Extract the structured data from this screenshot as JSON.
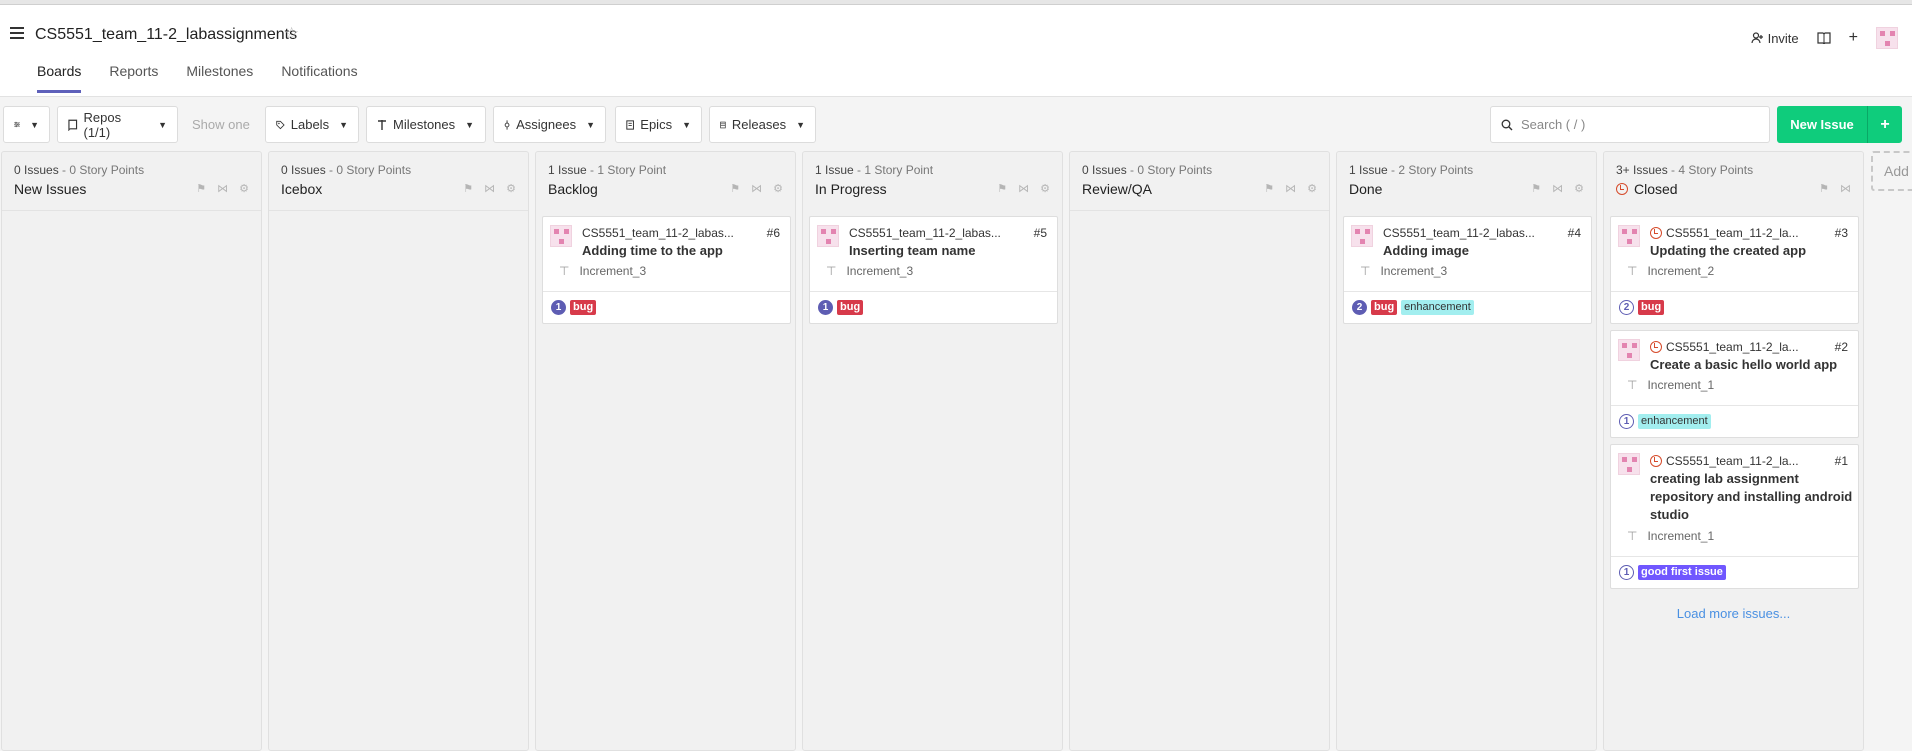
{
  "header": {
    "project_title": "CS5551_team_11-2_labassignments",
    "invite_label": "Invite",
    "tabs": [
      {
        "label": "Boards"
      },
      {
        "label": "Reports"
      },
      {
        "label": "Milestones"
      },
      {
        "label": "Notifications"
      }
    ]
  },
  "toolbar": {
    "repos_label": "Repos (1/1)",
    "show_one_label": "Show one",
    "labels_label": "Labels",
    "milestones_label": "Milestones",
    "assignees_label": "Assignees",
    "epics_label": "Epics",
    "releases_label": "Releases",
    "search_placeholder": "Search ( / )",
    "new_issue_label": "New Issue"
  },
  "columns": [
    {
      "count": "0 Issues",
      "points": " - 0 Story Points",
      "name": "New Issues"
    },
    {
      "count": "0 Issues",
      "points": " - 0 Story Points",
      "name": "Icebox"
    },
    {
      "count": "1 Issue",
      "points": " - 1 Story Point",
      "name": "Backlog"
    },
    {
      "count": "1 Issue",
      "points": " - 1 Story Point",
      "name": "In Progress"
    },
    {
      "count": "0 Issues",
      "points": " - 0 Story Points",
      "name": "Review/QA"
    },
    {
      "count": "1 Issue",
      "points": " - 2 Story Points",
      "name": "Done"
    },
    {
      "count": "3+ Issues",
      "points": " - 4 Story Points",
      "name": "Closed"
    }
  ],
  "cards": {
    "backlog": {
      "repo": "CS5551_team_11-2_labas...",
      "number": "#6",
      "title": "Adding time to the app",
      "milestone": "Increment_3",
      "estimate": "1",
      "labels": [
        "bug"
      ]
    },
    "inprogress": {
      "repo": "CS5551_team_11-2_labas...",
      "number": "#5",
      "title": "Inserting team name",
      "milestone": "Increment_3",
      "estimate": "1",
      "labels": [
        "bug"
      ]
    },
    "done": {
      "repo": "CS5551_team_11-2_labas...",
      "number": "#4",
      "title": "Adding image",
      "milestone": "Increment_3",
      "estimate": "2",
      "labels": [
        "bug",
        "enhancement"
      ]
    },
    "closed3": {
      "repo": "CS5551_team_11-2_la...",
      "number": "#3",
      "title": "Updating the created app",
      "milestone": "Increment_2",
      "estimate": "2",
      "labels": [
        "bug"
      ]
    },
    "closed2": {
      "repo": "CS5551_team_11-2_la...",
      "number": "#2",
      "title": "Create a basic hello world app",
      "milestone": "Increment_1",
      "estimate": "1",
      "labels": [
        "enhancement"
      ]
    },
    "closed1": {
      "repo": "CS5551_team_11-2_la...",
      "number": "#1",
      "title": "creating lab assignment repository and installing android studio",
      "milestone": "Increment_1",
      "estimate": "1",
      "labels": [
        "good first issue"
      ]
    }
  },
  "load_more_label": "Load more issues...",
  "add_column_label": "Add",
  "colors": {
    "accent": "#5e60ba",
    "new_issue": "#0fcc7c",
    "bug": "#d73a4a",
    "enhancement": "#a2eeef",
    "good_first_issue": "#7057ff",
    "closed": "#d64b2b"
  }
}
